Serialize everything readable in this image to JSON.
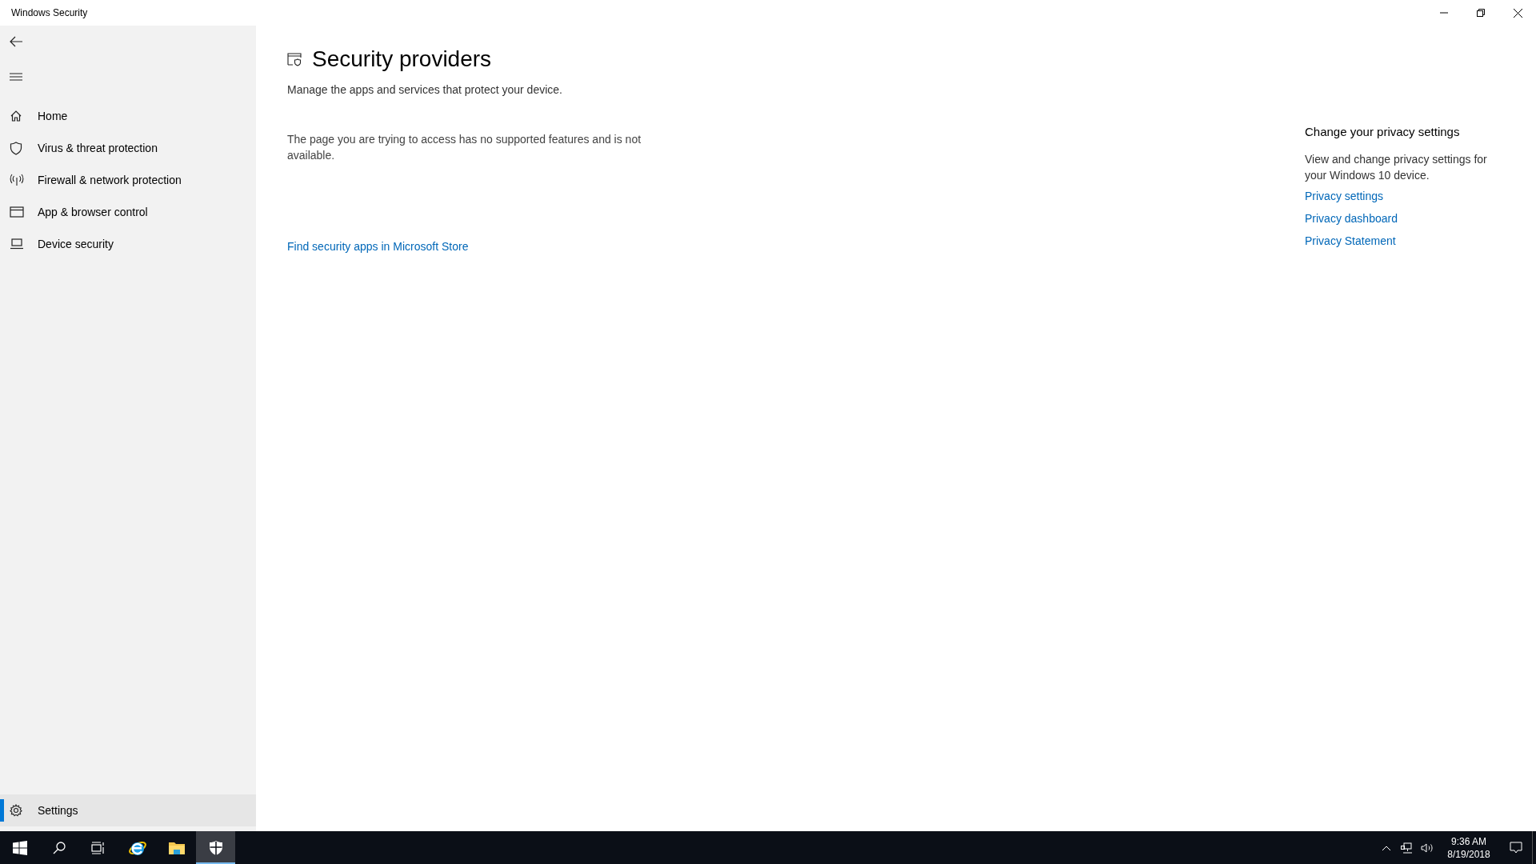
{
  "window": {
    "title": "Windows Security"
  },
  "sidebar": {
    "items": [
      {
        "kind": "home",
        "label": "Home",
        "selected": false
      },
      {
        "kind": "shield",
        "label": "Virus & threat protection",
        "selected": false
      },
      {
        "kind": "wifi",
        "label": "Firewall & network protection",
        "selected": false
      },
      {
        "kind": "browser",
        "label": "App & browser control",
        "selected": false
      },
      {
        "kind": "laptop",
        "label": "Device security",
        "selected": false
      }
    ],
    "settings": {
      "label": "Settings",
      "selected": true
    }
  },
  "page": {
    "title": "Security providers",
    "subtitle": "Manage the apps and services that protect your device.",
    "message": "The page you are trying to access has no supported features and is not available.",
    "store_link": "Find security apps in Microsoft Store"
  },
  "privacy": {
    "heading": "Change your privacy settings",
    "text": "View and change privacy settings for your Windows 10 device.",
    "links": [
      "Privacy settings",
      "Privacy dashboard",
      "Privacy Statement"
    ]
  },
  "taskbar": {
    "apps": [
      {
        "kind": "start",
        "selected": false
      },
      {
        "kind": "search",
        "selected": false
      },
      {
        "kind": "taskview",
        "selected": false
      },
      {
        "kind": "ie",
        "selected": false
      },
      {
        "kind": "explorer",
        "selected": false
      },
      {
        "kind": "security",
        "selected": true
      }
    ],
    "time": "9:36 AM",
    "date": "8/19/2018"
  }
}
